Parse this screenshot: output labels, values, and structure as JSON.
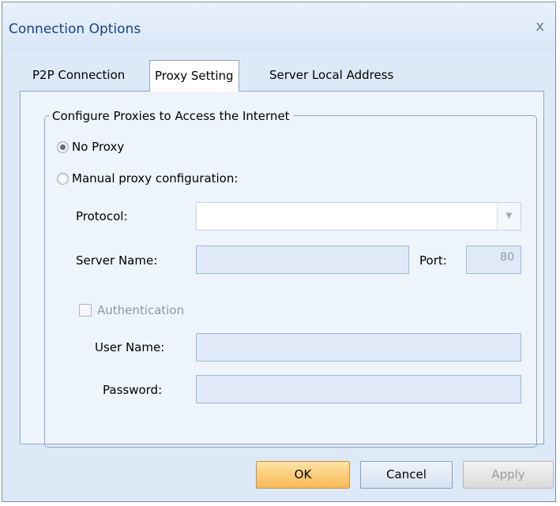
{
  "window": {
    "title": "Connection Options",
    "close_glyph": "x"
  },
  "tabs": [
    {
      "label": "P2P Connection",
      "active": false
    },
    {
      "label": "Proxy Setting",
      "active": true
    },
    {
      "label": "Server Local Address",
      "active": false
    }
  ],
  "group": {
    "legend": "Configure Proxies to Access the Internet"
  },
  "options": {
    "no_proxy": {
      "label": "No Proxy",
      "checked": true
    },
    "manual": {
      "label": "Manual proxy configuration:",
      "checked": false
    }
  },
  "protocol": {
    "label": "Protocol:",
    "value": ""
  },
  "server": {
    "label": "Server Name:",
    "value": ""
  },
  "port": {
    "label": "Port:",
    "value": "80"
  },
  "auth": {
    "label": "Authentication",
    "checked": false,
    "enabled": false
  },
  "user": {
    "label": "User Name:",
    "value": ""
  },
  "password": {
    "label": "Password:",
    "value": ""
  },
  "buttons": {
    "ok": "OK",
    "cancel": "Cancel",
    "apply": "Apply"
  },
  "colors": {
    "accent": "#15428b",
    "ok_button": "#f8b858",
    "panel_bg": "#eef4fc"
  }
}
